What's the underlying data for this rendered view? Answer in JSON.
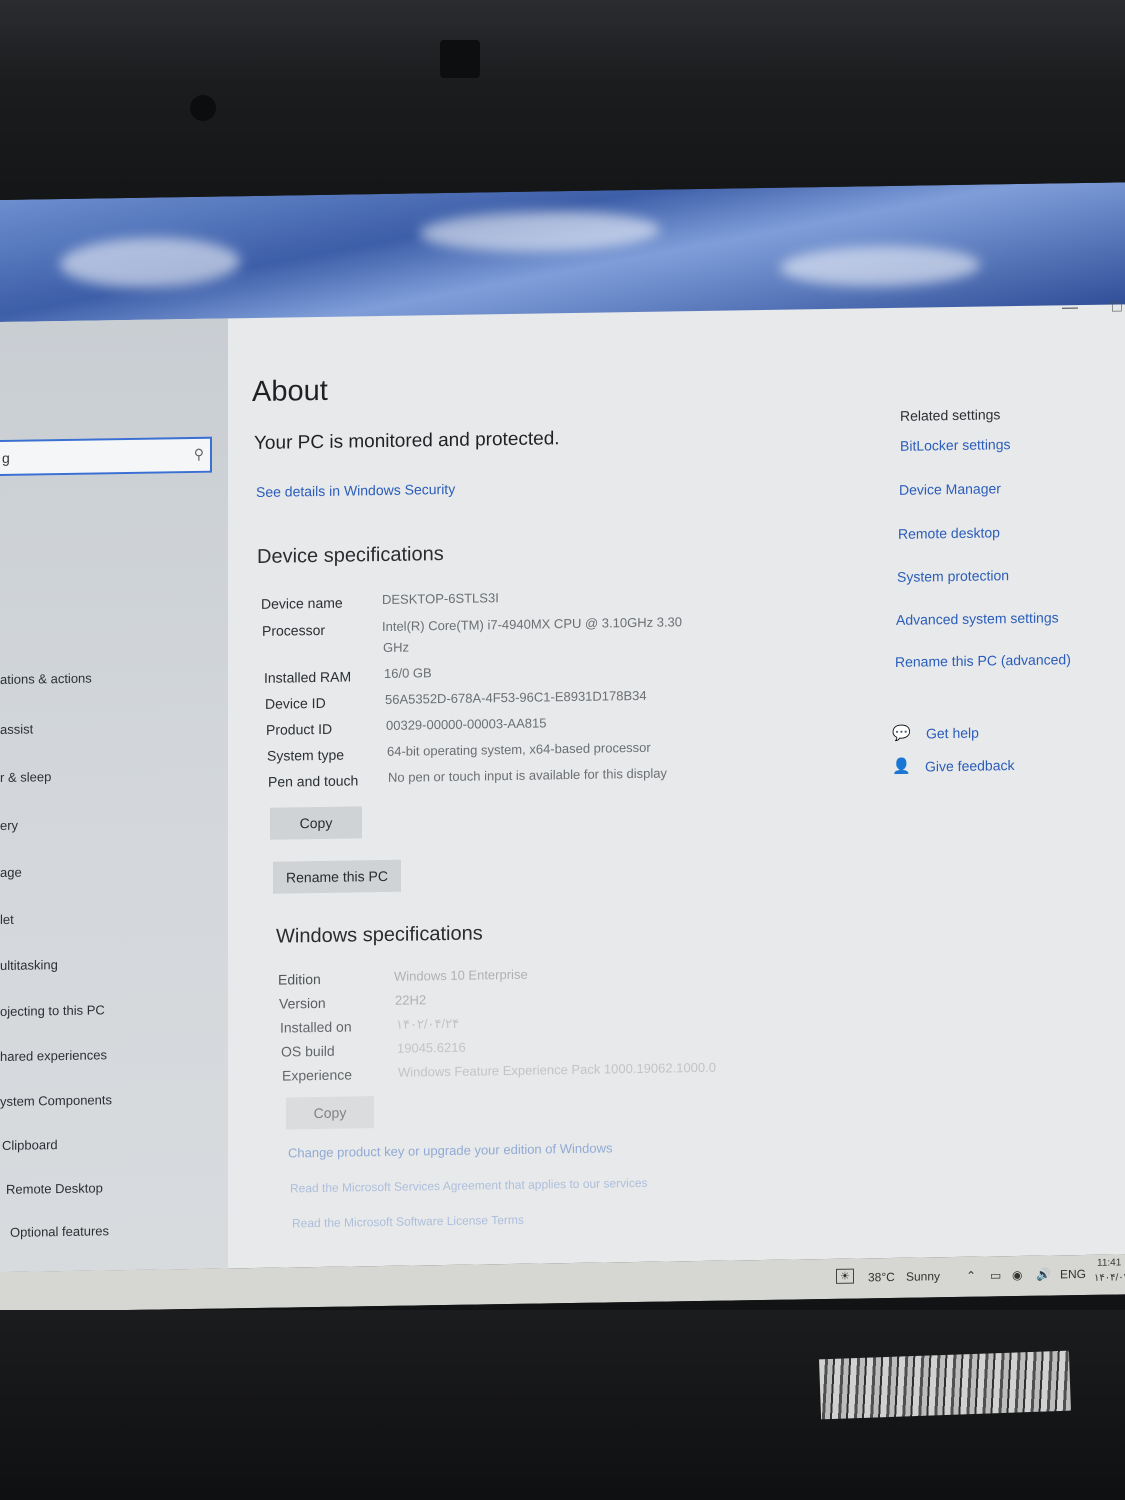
{
  "window": {
    "minimize_icon": "minimize-icon",
    "maximize_icon": "maximize-icon"
  },
  "sidebar": {
    "search_value": "g",
    "search_icon": "search-icon",
    "items": [
      {
        "label": "ations & actions"
      },
      {
        "label": "assist"
      },
      {
        "label": "r & sleep"
      },
      {
        "label": "ery"
      },
      {
        "label": "age"
      },
      {
        "label": "let"
      },
      {
        "label": "ultitasking"
      },
      {
        "label": "ojecting to this PC"
      },
      {
        "label": "hared experiences"
      },
      {
        "label": "ystem Components"
      },
      {
        "label": "Clipboard"
      },
      {
        "label": "Remote Desktop"
      },
      {
        "label": "Optional features"
      }
    ]
  },
  "about": {
    "title": "About",
    "protection_status": "Your PC is monitored and protected.",
    "security_link": "See details in Windows Security"
  },
  "device_specs": {
    "heading": "Device specifications",
    "rows": [
      {
        "label": "Device name",
        "value": "DESKTOP-6STLS3I"
      },
      {
        "label": "Processor",
        "value": "Intel(R) Core(TM) i7-4940MX CPU @ 3.10GHz   3.30",
        "value2": "GHz"
      },
      {
        "label": "Installed RAM",
        "value": "16/0 GB"
      },
      {
        "label": "Device ID",
        "value": "56A5352D-678A-4F53-96C1-E8931D178B34"
      },
      {
        "label": "Product ID",
        "value": "00329-00000-00003-AA815"
      },
      {
        "label": "System type",
        "value": "64-bit operating system, x64-based processor"
      },
      {
        "label": "Pen and touch",
        "value": "No pen or touch input is available for this display"
      }
    ],
    "copy_button": "Copy",
    "rename_button": "Rename this PC"
  },
  "windows_specs": {
    "heading": "Windows specifications",
    "rows": [
      {
        "label": "Edition",
        "value": "Windows 10 Enterprise"
      },
      {
        "label": "Version",
        "value": "22H2"
      },
      {
        "label": "Installed on",
        "value": "۱۴۰۲/۰۴/۲۴"
      },
      {
        "label": "OS build",
        "value": "19045.6216"
      },
      {
        "label": "Experience",
        "value": "Windows Feature Experience Pack 1000.19062.1000.0"
      }
    ],
    "copy_button": "Copy",
    "links": [
      "Change product key or upgrade your edition of Windows",
      "Read the Microsoft Services Agreement that applies to our services",
      "Read the Microsoft Software License Terms"
    ]
  },
  "related": {
    "title": "Related settings",
    "links": [
      "BitLocker settings",
      "Device Manager",
      "Remote desktop",
      "System protection",
      "Advanced system settings",
      "Rename this PC (advanced)"
    ],
    "help": "Get help",
    "feedback": "Give feedback"
  },
  "taskbar": {
    "weather_temp": "38°C",
    "weather_desc": "Sunny",
    "lang": "ENG",
    "time": "11:41",
    "date": "۱۴۰۴/۰۴/۲۱",
    "icons": [
      "chevron-up-icon",
      "battery-icon",
      "network-icon",
      "volume-icon"
    ]
  }
}
